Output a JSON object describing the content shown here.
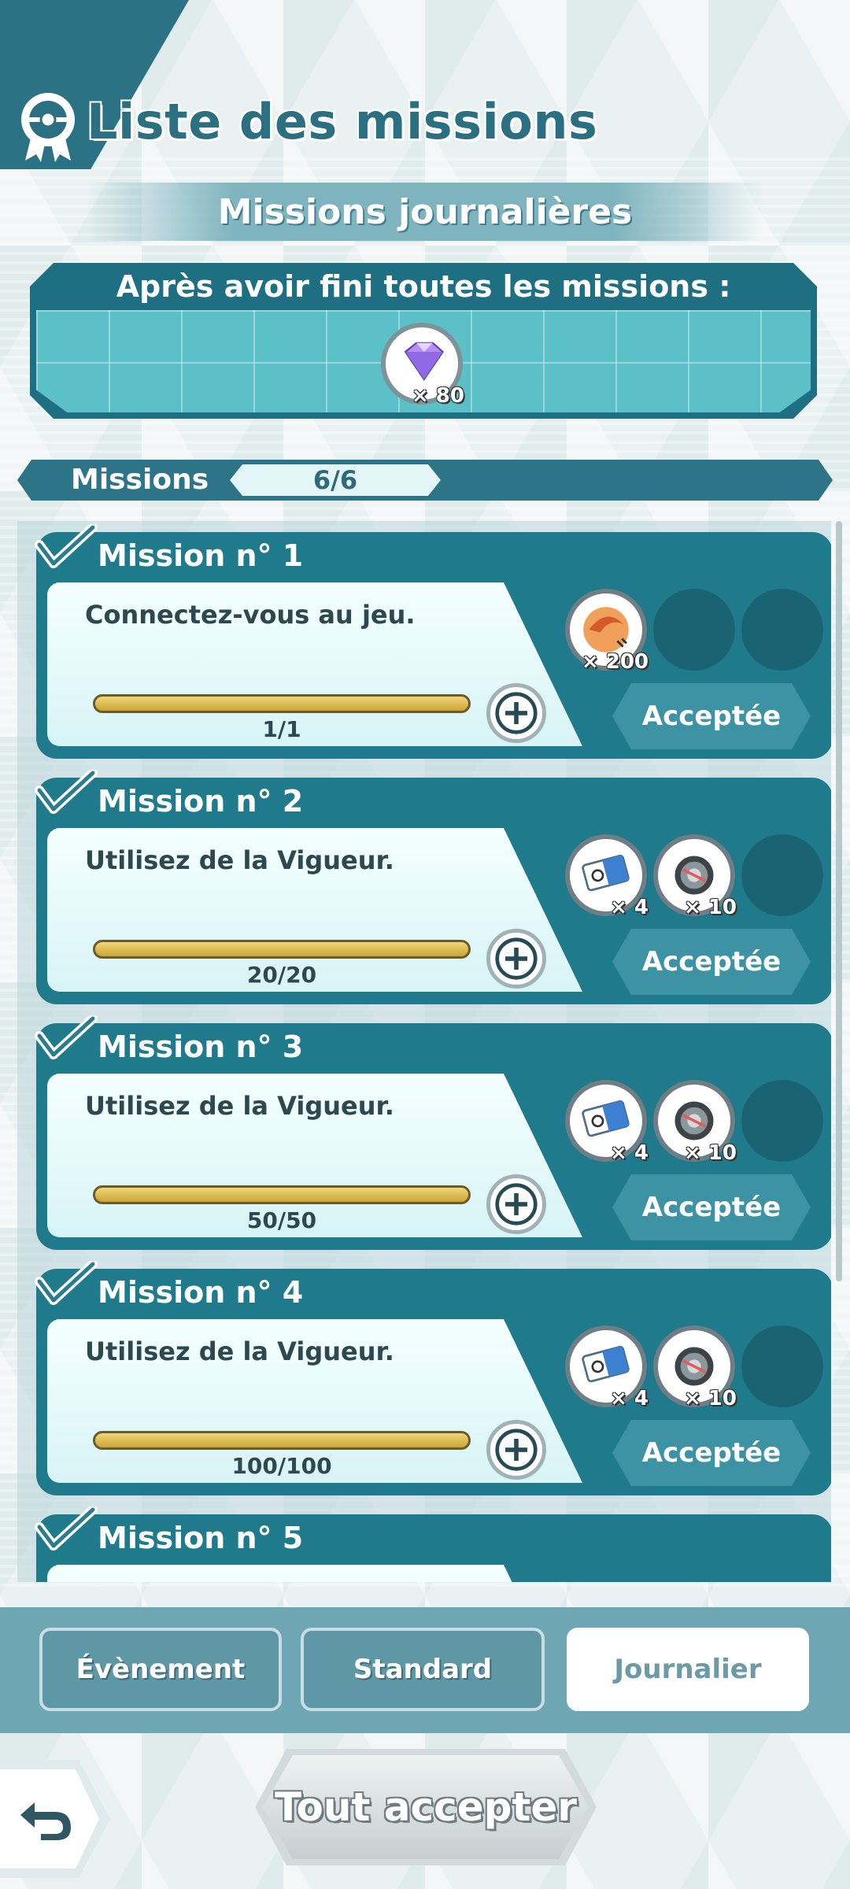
{
  "header": {
    "title": "Liste des missions"
  },
  "subheader": {
    "title": "Missions journalières"
  },
  "completion_reward": {
    "label": "Après avoir fini toutes les missions :",
    "item_icon": "gem-icon",
    "quantity": "× 80"
  },
  "missions_counter": {
    "label": "Missions",
    "value": "6/6"
  },
  "missions": [
    {
      "title": "Mission n° 1",
      "description": "Connectez-vous au jeu.",
      "progress_text": "1/1",
      "progress": 1.0,
      "rewards": [
        {
          "icon": "orb-icon",
          "qty": "× 200"
        }
      ],
      "status": "Acceptée"
    },
    {
      "title": "Mission n° 2",
      "description": "Utilisez de la Vigueur.",
      "progress_text": "20/20",
      "progress": 1.0,
      "rewards": [
        {
          "icon": "ticket-icon",
          "qty": "× 4"
        },
        {
          "icon": "coin-icon",
          "qty": "× 10"
        }
      ],
      "status": "Acceptée"
    },
    {
      "title": "Mission n° 3",
      "description": "Utilisez de la Vigueur.",
      "progress_text": "50/50",
      "progress": 1.0,
      "rewards": [
        {
          "icon": "ticket-icon",
          "qty": "× 4"
        },
        {
          "icon": "coin-icon",
          "qty": "× 10"
        }
      ],
      "status": "Acceptée"
    },
    {
      "title": "Mission n° 4",
      "description": "Utilisez de la Vigueur.",
      "progress_text": "100/100",
      "progress": 1.0,
      "rewards": [
        {
          "icon": "ticket-icon",
          "qty": "× 4"
        },
        {
          "icon": "coin-icon",
          "qty": "× 10"
        }
      ],
      "status": "Acceptée"
    },
    {
      "title": "Mission n° 5"
    }
  ],
  "tabs": [
    {
      "label": "Évènement",
      "active": false
    },
    {
      "label": "Standard",
      "active": false
    },
    {
      "label": "Journalier",
      "active": true
    }
  ],
  "footer": {
    "accept_all_label": "Tout accepter",
    "back_icon": "back-arrow-icon"
  },
  "colors": {
    "primary": "#1f7a8c",
    "accent": "#2b6f82",
    "progress": "#e2c25a"
  }
}
